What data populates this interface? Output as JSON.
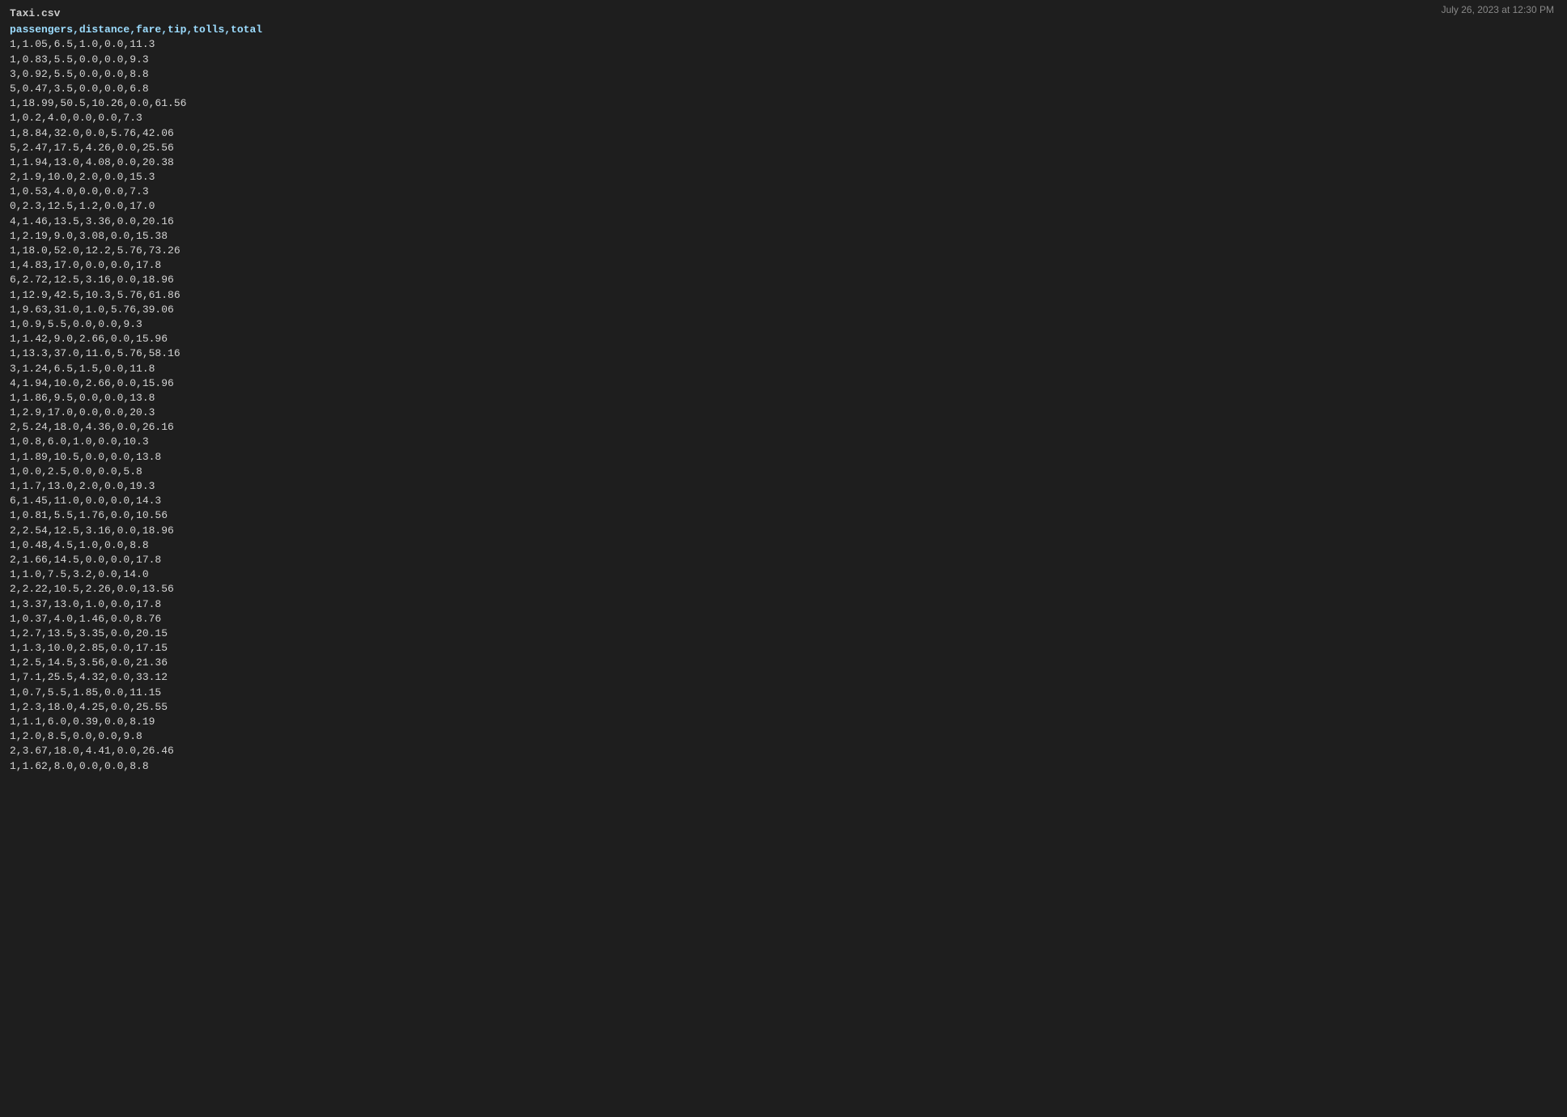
{
  "header": {
    "timestamp": "July 26, 2023 at 12:30 PM"
  },
  "file": {
    "name": "Taxi.csv",
    "columns": "passengers,distance,fare,tip,tolls,total",
    "rows": [
      "1,1.05,6.5,1.0,0.0,11.3",
      "1,0.83,5.5,0.0,0.0,9.3",
      "3,0.92,5.5,0.0,0.0,8.8",
      "5,0.47,3.5,0.0,0.0,6.8",
      "1,18.99,50.5,10.26,0.0,61.56",
      "1,0.2,4.0,0.0,0.0,7.3",
      "1,8.84,32.0,0.0,5.76,42.06",
      "5,2.47,17.5,4.26,0.0,25.56",
      "1,1.94,13.0,4.08,0.0,20.38",
      "2,1.9,10.0,2.0,0.0,15.3",
      "1,0.53,4.0,0.0,0.0,7.3",
      "0,2.3,12.5,1.2,0.0,17.0",
      "4,1.46,13.5,3.36,0.0,20.16",
      "1,2.19,9.0,3.08,0.0,15.38",
      "1,18.0,52.0,12.2,5.76,73.26",
      "1,4.83,17.0,0.0,0.0,17.8",
      "6,2.72,12.5,3.16,0.0,18.96",
      "1,12.9,42.5,10.3,5.76,61.86",
      "1,9.63,31.0,1.0,5.76,39.06",
      "1,0.9,5.5,0.0,0.0,9.3",
      "1,1.42,9.0,2.66,0.0,15.96",
      "1,13.3,37.0,11.6,5.76,58.16",
      "3,1.24,6.5,1.5,0.0,11.8",
      "4,1.94,10.0,2.66,0.0,15.96",
      "1,1.86,9.5,0.0,0.0,13.8",
      "1,2.9,17.0,0.0,0.0,20.3",
      "2,5.24,18.0,4.36,0.0,26.16",
      "1,0.8,6.0,1.0,0.0,10.3",
      "1,1.89,10.5,0.0,0.0,13.8",
      "1,0.0,2.5,0.0,0.0,5.8",
      "1,1.7,13.0,2.0,0.0,19.3",
      "6,1.45,11.0,0.0,0.0,14.3",
      "1,0.81,5.5,1.76,0.0,10.56",
      "2,2.54,12.5,3.16,0.0,18.96",
      "1,0.48,4.5,1.0,0.0,8.8",
      "2,1.66,14.5,0.0,0.0,17.8",
      "1,1.0,7.5,3.2,0.0,14.0",
      "2,2.22,10.5,2.26,0.0,13.56",
      "1,3.37,13.0,1.0,0.0,17.8",
      "1,0.37,4.0,1.46,0.0,8.76",
      "1,2.7,13.5,3.35,0.0,20.15",
      "1,1.3,10.0,2.85,0.0,17.15",
      "1,2.5,14.5,3.56,0.0,21.36",
      "1,7.1,25.5,4.32,0.0,33.12",
      "1,0.7,5.5,1.85,0.0,11.15",
      "1,2.3,18.0,4.25,0.0,25.55",
      "1,1.1,6.0,0.39,0.0,8.19",
      "1,2.0,8.5,0.0,0.0,9.8",
      "2,3.67,18.0,4.41,0.0,26.46",
      "1,1.62,8.0,0.0,0.0,8.8"
    ]
  }
}
